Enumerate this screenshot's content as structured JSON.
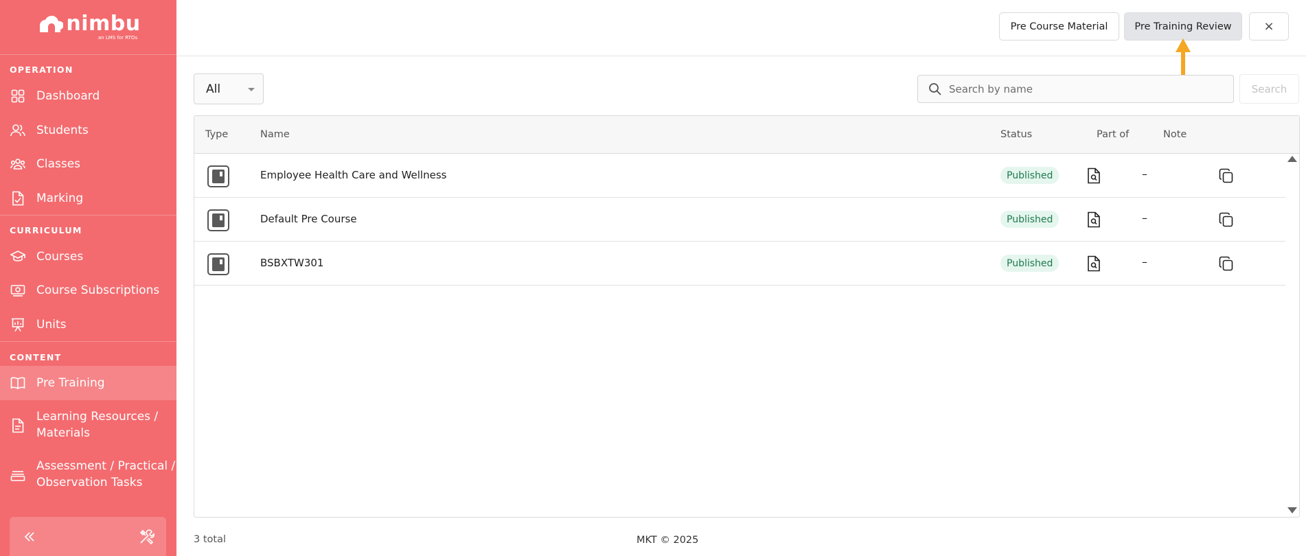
{
  "app": {
    "logo_text": "nimbu",
    "logo_tagline": "an LMS for RTOs"
  },
  "sidebar": {
    "sections": [
      {
        "label": "OPERATION"
      },
      {
        "label": "CURRICULUM"
      },
      {
        "label": "CONTENT"
      }
    ],
    "items": [
      {
        "label": "Dashboard",
        "icon": "dashboard-icon"
      },
      {
        "label": "Students",
        "icon": "users-icon"
      },
      {
        "label": "Classes",
        "icon": "group-icon"
      },
      {
        "label": "Marking",
        "icon": "check-document-icon"
      },
      {
        "label": "Courses",
        "icon": "graduation-cap-icon"
      },
      {
        "label": "Course Subscriptions",
        "icon": "subscription-icon"
      },
      {
        "label": "Units",
        "icon": "chart-board-icon"
      },
      {
        "label": "Pre Training",
        "icon": "book-icon",
        "active": true
      },
      {
        "label_line1": "Learning Resources /",
        "label_line2": "Materials",
        "icon": "file-icon"
      },
      {
        "label_line1": "Assessment / Practical /",
        "label_line2": "Observation Tasks",
        "icon": "tray-icon"
      }
    ]
  },
  "header": {
    "buttons": [
      {
        "label": "Pre Course Material"
      },
      {
        "label": "Pre Training Review",
        "active": true
      },
      {
        "label": "×"
      }
    ]
  },
  "filters": {
    "type_select": "All",
    "search_placeholder": "Search by name",
    "search_button": "Search"
  },
  "table": {
    "columns": [
      "Type",
      "Name",
      "Status",
      "Part of",
      "Note"
    ],
    "rows": [
      {
        "name": "Employee Health Care and Wellness",
        "status": "Published",
        "note": "–"
      },
      {
        "name": "Default Pre Course",
        "status": "Published",
        "note": "–"
      },
      {
        "name": "BSBXTW301",
        "status": "Published",
        "note": "–"
      }
    ]
  },
  "summary": {
    "total": "3 total",
    "footer": "MKT © 2025"
  },
  "colors": {
    "sidebar_bg": "#f36b6f",
    "badge_bg": "#e5f6ee",
    "badge_text": "#1f7a4f",
    "annotation_arrow": "#f5a623"
  }
}
